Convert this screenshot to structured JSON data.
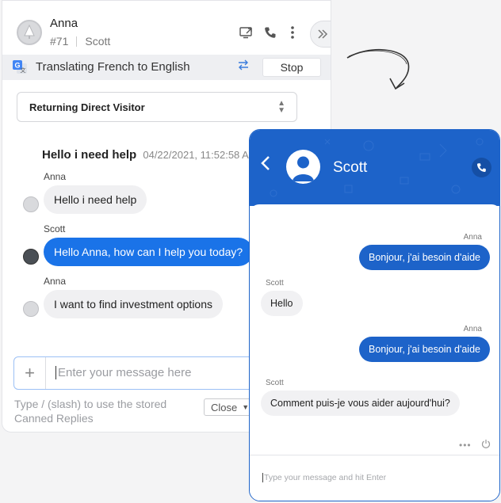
{
  "agent": {
    "visitor_name": "Anna",
    "chat_id": "#71",
    "agent_name": "Scott",
    "translate_text": "Translating French to English",
    "stop_label": "Stop",
    "visitor_type": "Returning Direct Visitor",
    "first_message": "Hello i need help",
    "first_timestamp": "04/22/2021, 11:52:58 A",
    "messages": [
      {
        "sender": "Anna",
        "text": "Hello i need help"
      },
      {
        "sender": "Scott",
        "text": "Hello Anna, how can I help you today?"
      },
      {
        "sender": "Anna",
        "text": "I want to find investment options"
      }
    ],
    "composer_placeholder": "Enter your message here",
    "canned_hint": "Type / (slash) to use the stored Canned Replies",
    "close_label": "Close"
  },
  "widget": {
    "title": "Scott",
    "messages": [
      {
        "sender": "Anna",
        "text": "Bonjour, j'ai besoin d'aide"
      },
      {
        "sender": "Scott",
        "text": "Hello"
      },
      {
        "sender": "Anna",
        "text": "Bonjour, j'ai besoin d'aide"
      },
      {
        "sender": "Scott",
        "text": "Comment puis-je vous aider aujourd'hui?"
      }
    ],
    "tools_dots": "•••",
    "input_placeholder": "Type your message and hit Enter"
  },
  "colors": {
    "brand_blue": "#1d63c9",
    "agent_bubble_blue": "#1a73e8",
    "visitor_bubble_gray": "#f0f0f2"
  },
  "icons": [
    "screen-share-icon",
    "phone-icon",
    "more-vertical-icon",
    "collapse-chevron-icon",
    "google-translate-icon",
    "swap-arrows-icon",
    "sort-updown-icon",
    "plus-icon",
    "back-chevron-icon",
    "user-avatar-icon",
    "power-icon"
  ]
}
